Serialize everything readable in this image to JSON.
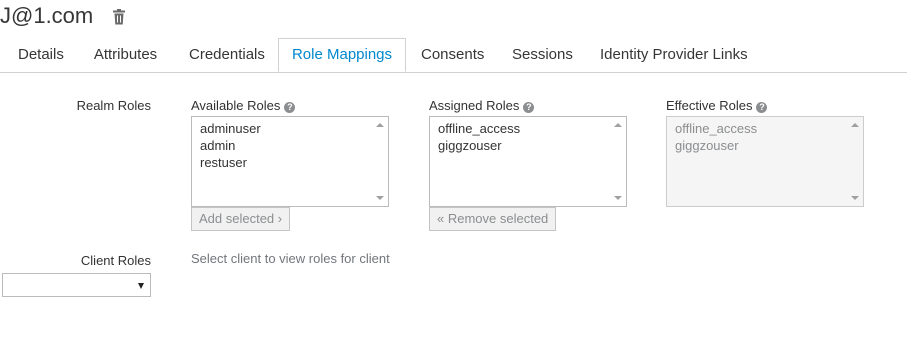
{
  "header": {
    "title": "J@1.com",
    "delete_icon": "trash-icon"
  },
  "tabs": [
    {
      "label": "Details"
    },
    {
      "label": "Attributes"
    },
    {
      "label": "Credentials"
    },
    {
      "label": "Role Mappings",
      "active": true
    },
    {
      "label": "Consents"
    },
    {
      "label": "Sessions"
    },
    {
      "label": "Identity Provider Links"
    }
  ],
  "realm_roles": {
    "label": "Realm Roles",
    "available": {
      "label": "Available Roles",
      "items": [
        "adminuser",
        "admin",
        "restuser"
      ],
      "button": "Add selected ›"
    },
    "assigned": {
      "label": "Assigned Roles",
      "items": [
        "offline_access",
        "giggzouser"
      ],
      "button": "« Remove selected"
    },
    "effective": {
      "label": "Effective Roles",
      "items": [
        "offline_access",
        "giggzouser"
      ]
    }
  },
  "client_roles": {
    "label": "Client Roles",
    "hint": "Select client to view roles for client",
    "selected": ""
  },
  "colors": {
    "accent": "#0088ce",
    "border": "#d1d1d1"
  }
}
